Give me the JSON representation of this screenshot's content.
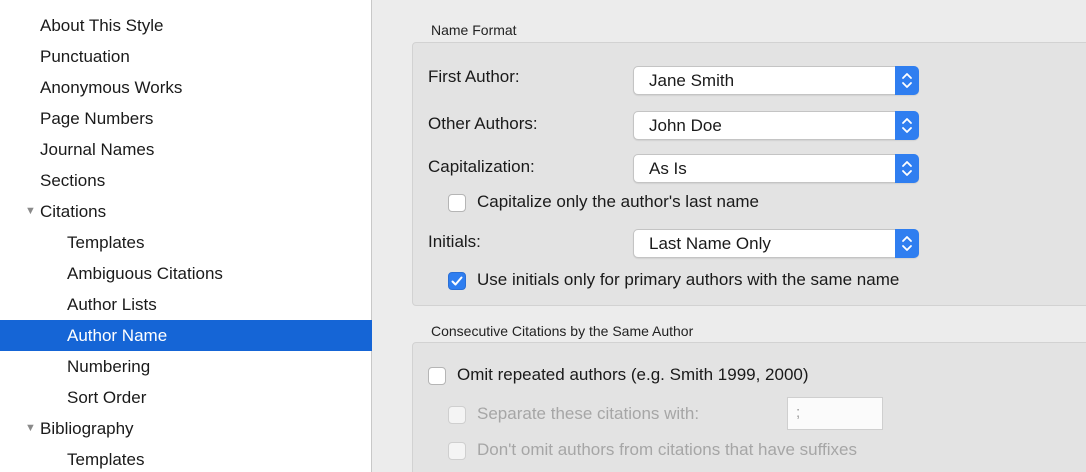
{
  "sidebar": {
    "items": [
      {
        "label": "About This Style"
      },
      {
        "label": "Punctuation"
      },
      {
        "label": "Anonymous Works"
      },
      {
        "label": "Page Numbers"
      },
      {
        "label": "Journal Names"
      },
      {
        "label": "Sections"
      },
      {
        "label": "Citations",
        "expanded": true
      },
      {
        "label": "Templates"
      },
      {
        "label": "Ambiguous Citations"
      },
      {
        "label": "Author Lists"
      },
      {
        "label": "Author Name",
        "selected": true
      },
      {
        "label": "Numbering"
      },
      {
        "label": "Sort Order"
      },
      {
        "label": "Bibliography",
        "expanded": true
      },
      {
        "label": "Templates"
      }
    ]
  },
  "name_format": {
    "title": "Name Format",
    "first_author": {
      "label": "First Author:",
      "value": "Jane Smith"
    },
    "other_authors": {
      "label": "Other Authors:",
      "value": "John Doe"
    },
    "capitalization": {
      "label": "Capitalization:",
      "value": "As Is"
    },
    "capitalize_last_name": {
      "label": "Capitalize only the author's last name",
      "checked": false
    },
    "initials": {
      "label": "Initials:",
      "value": "Last Name Only"
    },
    "use_initials": {
      "label": "Use initials only for primary authors with the same name",
      "checked": true
    }
  },
  "consecutive": {
    "title": "Consecutive Citations by the Same Author",
    "omit_repeated": {
      "label": "Omit repeated authors (e.g. Smith 1999, 2000)",
      "checked": false
    },
    "separate": {
      "label": "Separate these citations with:",
      "value": ";",
      "enabled": false
    },
    "dont_omit": {
      "label": "Don't omit authors from citations that have suffixes",
      "enabled": false
    }
  },
  "colors": {
    "accent": "#2f7ef0",
    "selection": "#1565d6"
  }
}
